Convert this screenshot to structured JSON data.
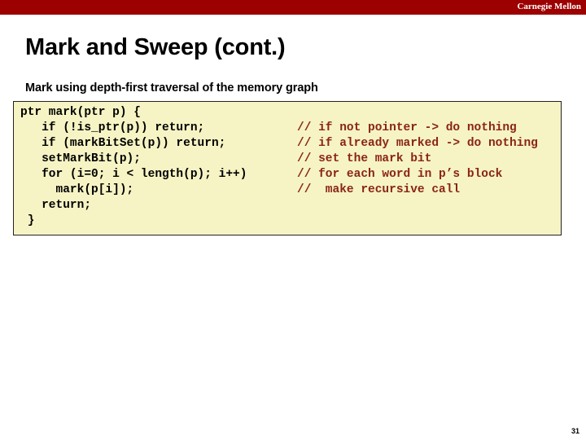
{
  "brand": {
    "name": "Carnegie Mellon",
    "bar_color": "#9c0000",
    "text_color": "#ffffff"
  },
  "slide": {
    "title": "Mark and Sweep (cont.)",
    "subtitle": "Mark using depth-first traversal of the memory graph",
    "page_number": "31"
  },
  "code_block": {
    "background_color": "#f6f4c4",
    "border_color": "#222222",
    "code_color": "#000000",
    "comment_color": "#8a2418",
    "lines": [
      {
        "code": "ptr mark(ptr p) {",
        "comment": ""
      },
      {
        "code": "   if (!is_ptr(p)) return;",
        "comment": "// if not pointer -> do nothing"
      },
      {
        "code": "   if (markBitSet(p)) return;",
        "comment": "// if already marked -> do nothing"
      },
      {
        "code": "   setMarkBit(p);",
        "comment": "// set the mark bit"
      },
      {
        "code": "   for (i=0; i < length(p); i++)",
        "comment": "// for each word in p’s block"
      },
      {
        "code": "     mark(p[i]);",
        "comment": "//  make recursive call"
      },
      {
        "code": "   return;",
        "comment": ""
      },
      {
        "code": " }",
        "comment": ""
      }
    ]
  }
}
